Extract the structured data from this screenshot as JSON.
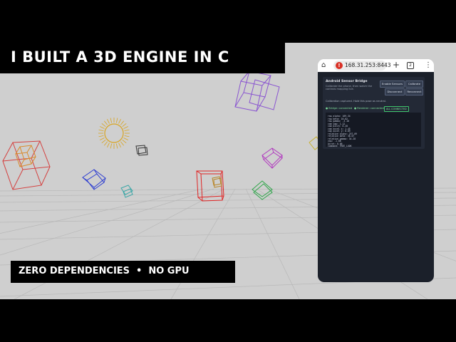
{
  "overlay": {
    "title": "I BUILT A 3D ENGINE IN C",
    "subtitle_left": "ZERO DEPENDENCIES",
    "subtitle_separator": "•",
    "subtitle_right": "NO GPU"
  },
  "colors": {
    "stage_background": "#cfcfcf",
    "banner_background": "#000000",
    "banner_text": "#ffffff",
    "app_background": "#1b202a",
    "status_green": "#7fe19b"
  },
  "scene": {
    "objects": [
      {
        "name": "red-cube",
        "color": "#d4403f"
      },
      {
        "name": "orange-inner-cube",
        "color": "#d98a2b"
      },
      {
        "name": "sun-sphere",
        "color": "#d9a520"
      },
      {
        "name": "purple-cube",
        "color": "#8a55d0"
      },
      {
        "name": "small-dark-cube",
        "color": "#333333"
      },
      {
        "name": "blue-cube",
        "color": "#2f3fd0"
      },
      {
        "name": "teal-cube",
        "color": "#3aa7a7"
      },
      {
        "name": "red-center-cube",
        "color": "#e02424"
      },
      {
        "name": "magenta-cube",
        "color": "#b13bbf"
      },
      {
        "name": "green-cube",
        "color": "#2fa64a"
      },
      {
        "name": "yellow-cube",
        "color": "#c8b030"
      }
    ]
  },
  "browser": {
    "home_icon": "home-icon",
    "security_icon": "insecure-warning-icon",
    "url": "168.31.253:8443",
    "new_tab_icon": "plus-icon",
    "tab_count": "2",
    "menu_icon": "more-vert-icon"
  },
  "app": {
    "title": "Android Sensor Bridge",
    "description": "Calibrate the phone, then watch the controls mapping live.",
    "buttons": {
      "enable_sensors": "Enable Sensors",
      "calibrate": "Calibrate",
      "disconnect": "Disconnect",
      "reconnect": "Reconnect"
    },
    "note": "Calibration captured. Hold this pose as neutral.",
    "status": {
      "bridge": "● Bridge: connected",
      "renderer": "● Renderer: connected",
      "badge": "ALL CONNECTED"
    },
    "readout": [
      "raw alpha: 169.34",
      "raw beta: 16.02",
      "raw gamma: -3.18",
      "cam yaw: 1.12",
      "cam pitch: 0.28",
      "cam accel x: 1.45",
      "cam accel y: 0.09",
      "relative alpha: 257.09",
      "relative beta: 36.07",
      "relative gamma: 34.28",
      "yaw: -1.88",
      "pitch: 0.06",
      "command: FREE_LOOK"
    ]
  }
}
